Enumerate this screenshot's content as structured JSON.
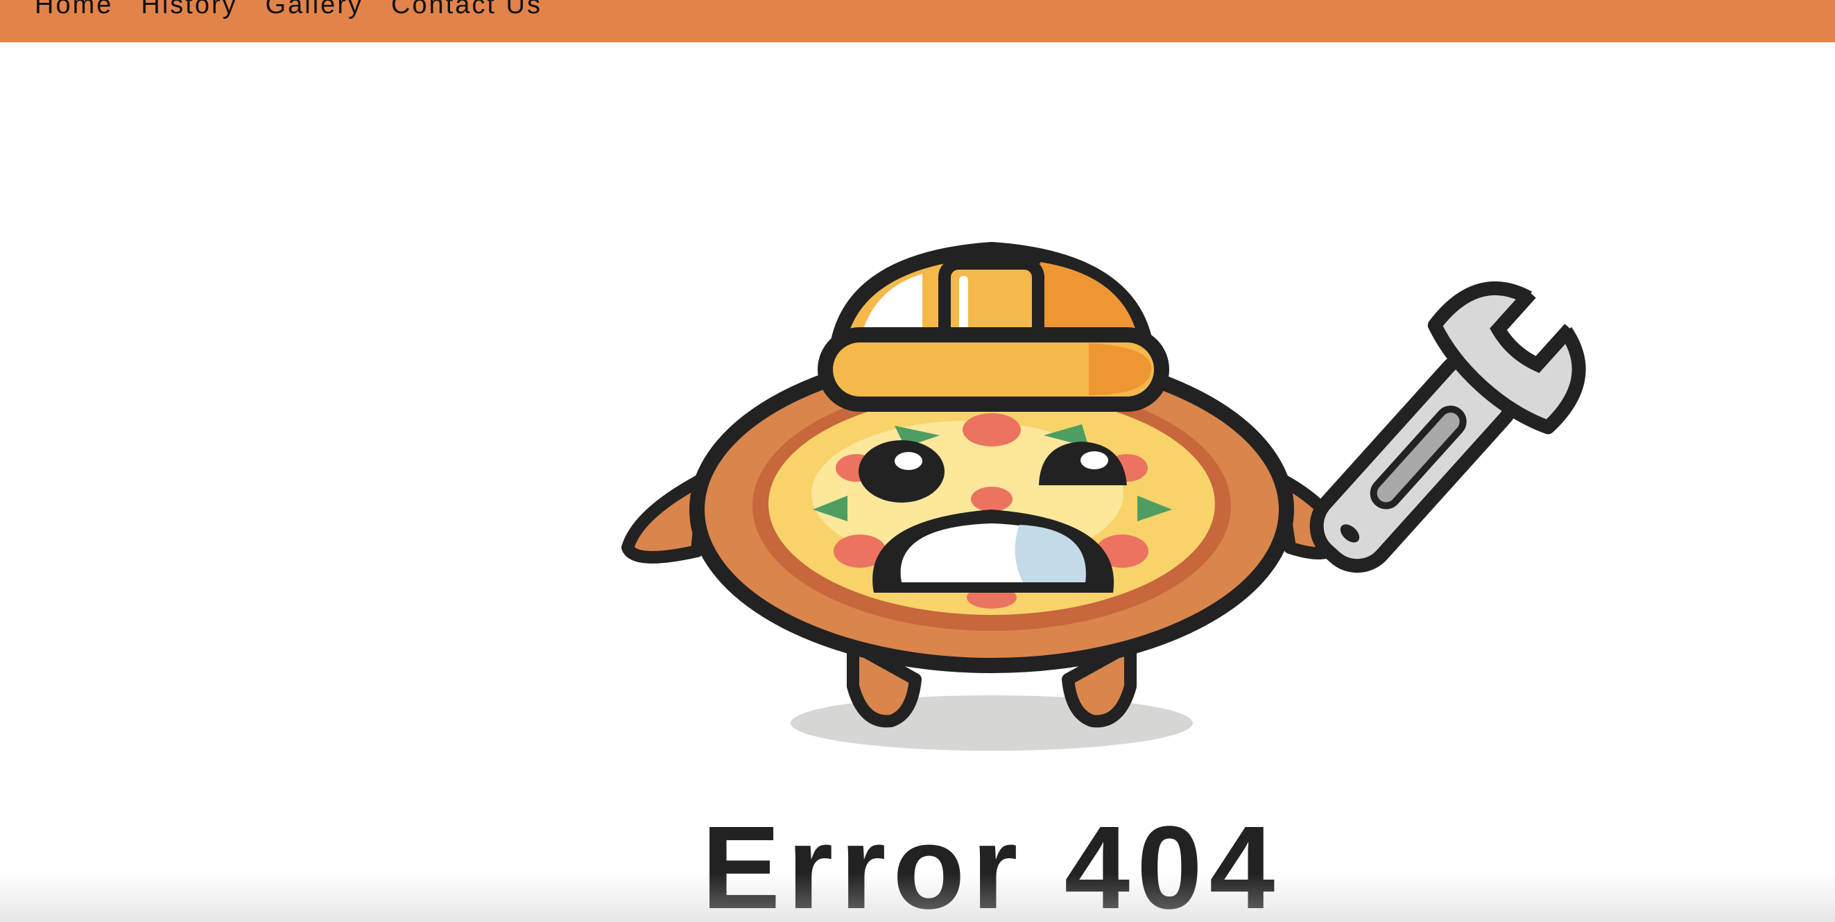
{
  "colors": {
    "nav_bg": "#e2834a",
    "nav_text": "#111111",
    "outline": "#222222",
    "helmet": "#f5b84a",
    "helmet_shade": "#ef9634",
    "crust": "#d9854c",
    "crust_dark": "#c8663c",
    "cheese": "#f7d36a",
    "cheese_light": "#fce79b",
    "pepperoni": "#ec7360",
    "basil": "#4e9e62",
    "wrench": "#d8d8d8",
    "wrench_slot": "#a8a8a8",
    "shadow": "#d6d6d4",
    "error_text": "#222222"
  },
  "nav": {
    "items": [
      {
        "label": "Home"
      },
      {
        "label": "History"
      },
      {
        "label": "Gallery"
      },
      {
        "label": "Contact Us"
      }
    ]
  },
  "hero": {
    "illustration": "pizza-mascot-with-hard-hat-and-wrench",
    "error_text": "Error 404"
  }
}
